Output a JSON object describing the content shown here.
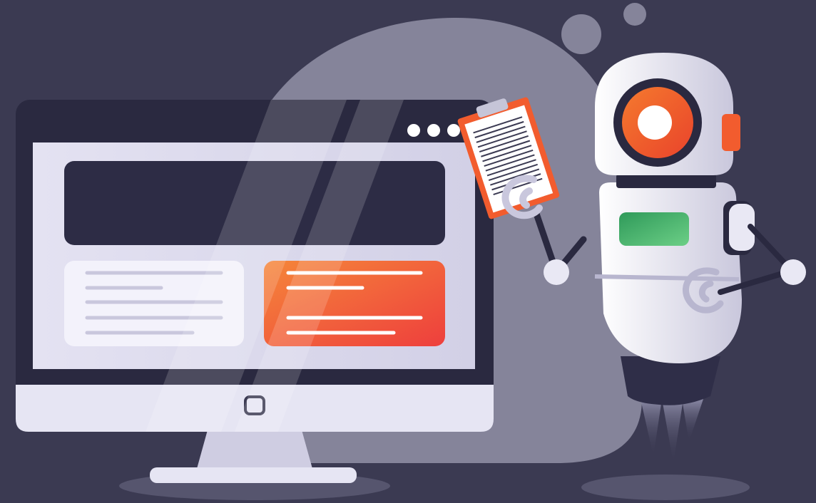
{
  "scene": {
    "background_color": "#3b3a52",
    "backdrop_blob_color": "#85849a",
    "shadow_color": "#53526a"
  },
  "monitor": {
    "frame_color": "#2a2940",
    "screen_color": "#dedcef",
    "title_bar_color": "#2a2940",
    "window_controls": [
      "dot",
      "dot",
      "dot"
    ],
    "hero_panel_color": "#2d2c45",
    "card_left_color": "#f3f2fb",
    "card_right_colors": [
      "#f27a3a",
      "#ee4a3d"
    ],
    "bottom_bezel_color": "#e6e5f3",
    "home_button_icon": "square-button-icon",
    "stand_color": "#d3d1e5"
  },
  "robot": {
    "body_color": "#e9e8f4",
    "eye_ring_color": "#f25c2e",
    "eye_color": "#ffffff",
    "ear_color": "#f25c2e",
    "chest_panel_color": "#35a461",
    "jet_flame_color": "#7e7f9b",
    "held_item": "clipboard-icon"
  },
  "clipboard": {
    "border_color": "#f25c2e",
    "paper_color": "#ffffff",
    "clip_color": "#c6c5d8"
  }
}
